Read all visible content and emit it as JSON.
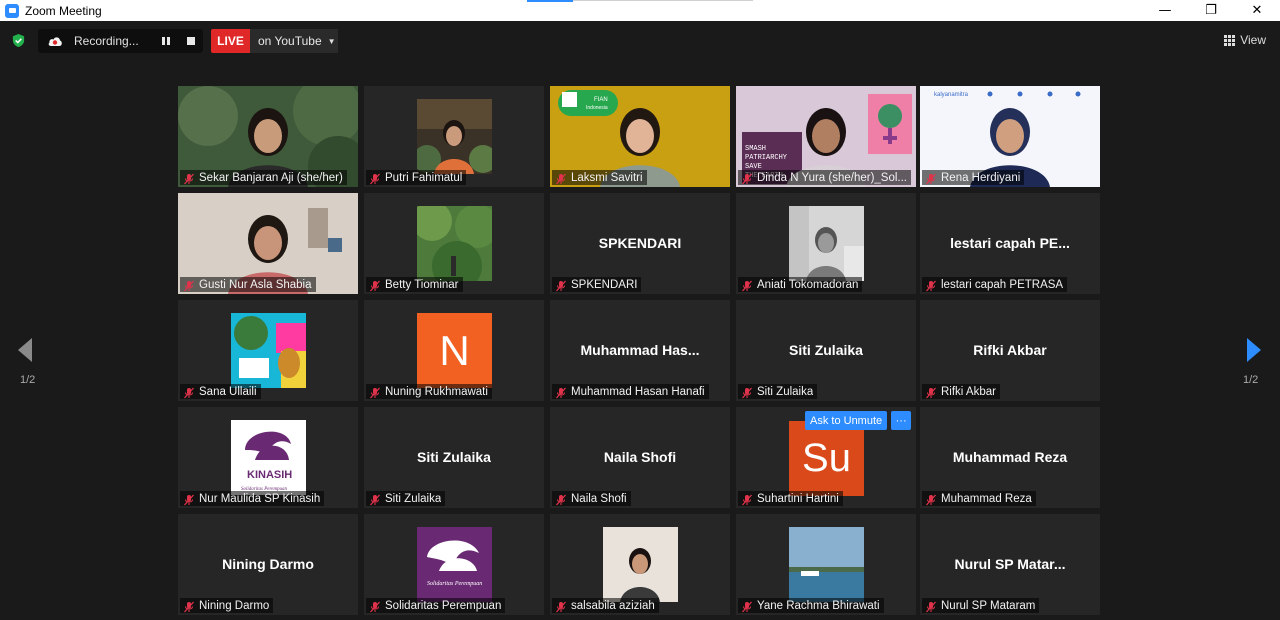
{
  "window": {
    "title": "Zoom Meeting",
    "minimize": "—",
    "maximize": "❐",
    "close": "✕"
  },
  "toolbar": {
    "recording_label": "Recording...",
    "live_label": "LIVE",
    "stream_target": "on YouTube",
    "view_label": "View"
  },
  "pagination": {
    "left": "1/2",
    "right": "1/2"
  },
  "unmute_popover": {
    "ask_label": "Ask to Unmute",
    "more_label": "···"
  },
  "participants": [
    {
      "name": "Sekar Banjaran Aji (she/her)",
      "display": "video",
      "row": 0,
      "col": 0
    },
    {
      "name": "Putri Fahimatul",
      "display": "video-small",
      "row": 0,
      "col": 1
    },
    {
      "name": "Laksmi Savitri",
      "display": "video",
      "row": 0,
      "col": 2,
      "tag": "FIAN Indonesia"
    },
    {
      "name": "Dinda N Yura (she/her)_Sol...",
      "display": "video",
      "row": 0,
      "col": 3,
      "tag": "SMASH PATRIARCHY SAVE THE EARTH"
    },
    {
      "name": "Rena Herdiyani",
      "display": "video",
      "row": 0,
      "col": 4,
      "active": true,
      "tag": "kalyanamitra"
    },
    {
      "name": "Gusti Nur Asla Shabia",
      "display": "video",
      "row": 1,
      "col": 0
    },
    {
      "name": "Betty Tiominar",
      "display": "video-small",
      "row": 1,
      "col": 1
    },
    {
      "name": "SPKENDARI",
      "big": "SPKENDARI",
      "display": "name",
      "row": 1,
      "col": 2
    },
    {
      "name": "Aniati Tokomadoran",
      "display": "video-small",
      "row": 1,
      "col": 3
    },
    {
      "name": "lestari capah PETRASA",
      "big": "lestari capah PE...",
      "display": "name",
      "row": 1,
      "col": 4
    },
    {
      "name": "Sana Ullaili",
      "display": "image",
      "row": 2,
      "col": 0
    },
    {
      "name": "Nuning Rukhmawati",
      "display": "initial",
      "initial": "N",
      "row": 2,
      "col": 1
    },
    {
      "name": "Muhammad Hasan Hanafi",
      "big": "Muhammad Has...",
      "display": "name",
      "row": 2,
      "col": 2
    },
    {
      "name": "Siti Zulaika",
      "big": "Siti Zulaika",
      "display": "name",
      "row": 2,
      "col": 3
    },
    {
      "name": "Rifki Akbar",
      "big": "Rifki Akbar",
      "display": "name",
      "row": 2,
      "col": 4
    },
    {
      "name": "Nur Maulida SP Kinasih",
      "display": "logo",
      "tag": "SP KINASIH",
      "row": 3,
      "col": 0
    },
    {
      "name": "Siti Zulaika",
      "big": "Siti Zulaika",
      "display": "name",
      "row": 3,
      "col": 1
    },
    {
      "name": "Naila Shofi",
      "big": "Naila Shofi",
      "display": "name",
      "row": 3,
      "col": 2
    },
    {
      "name": "Suhartini Hartini",
      "display": "initial",
      "initial": "Su",
      "row": 3,
      "col": 3
    },
    {
      "name": "Muhammad Reza",
      "big": "Muhammad Reza",
      "display": "name",
      "row": 3,
      "col": 4
    },
    {
      "name": "Nining Darmo",
      "big": "Nining Darmo",
      "display": "name",
      "row": 4,
      "col": 0
    },
    {
      "name": "Solidaritas Perempuan",
      "display": "logo2",
      "row": 4,
      "col": 1
    },
    {
      "name": "salsabila aziziah",
      "display": "video-small",
      "row": 4,
      "col": 2
    },
    {
      "name": "Yane Rachma Bhirawati",
      "display": "video-small",
      "row": 4,
      "col": 3
    },
    {
      "name": "Nurul SP Mataram",
      "big": "Nurul SP Matar...",
      "display": "name",
      "row": 4,
      "col": 4
    }
  ],
  "colors": {
    "accent": "#2d8cff",
    "live": "#e02828",
    "initial_bg": "#f26122",
    "active_border": "#d7e866",
    "mic_muted": "#e0334b"
  }
}
